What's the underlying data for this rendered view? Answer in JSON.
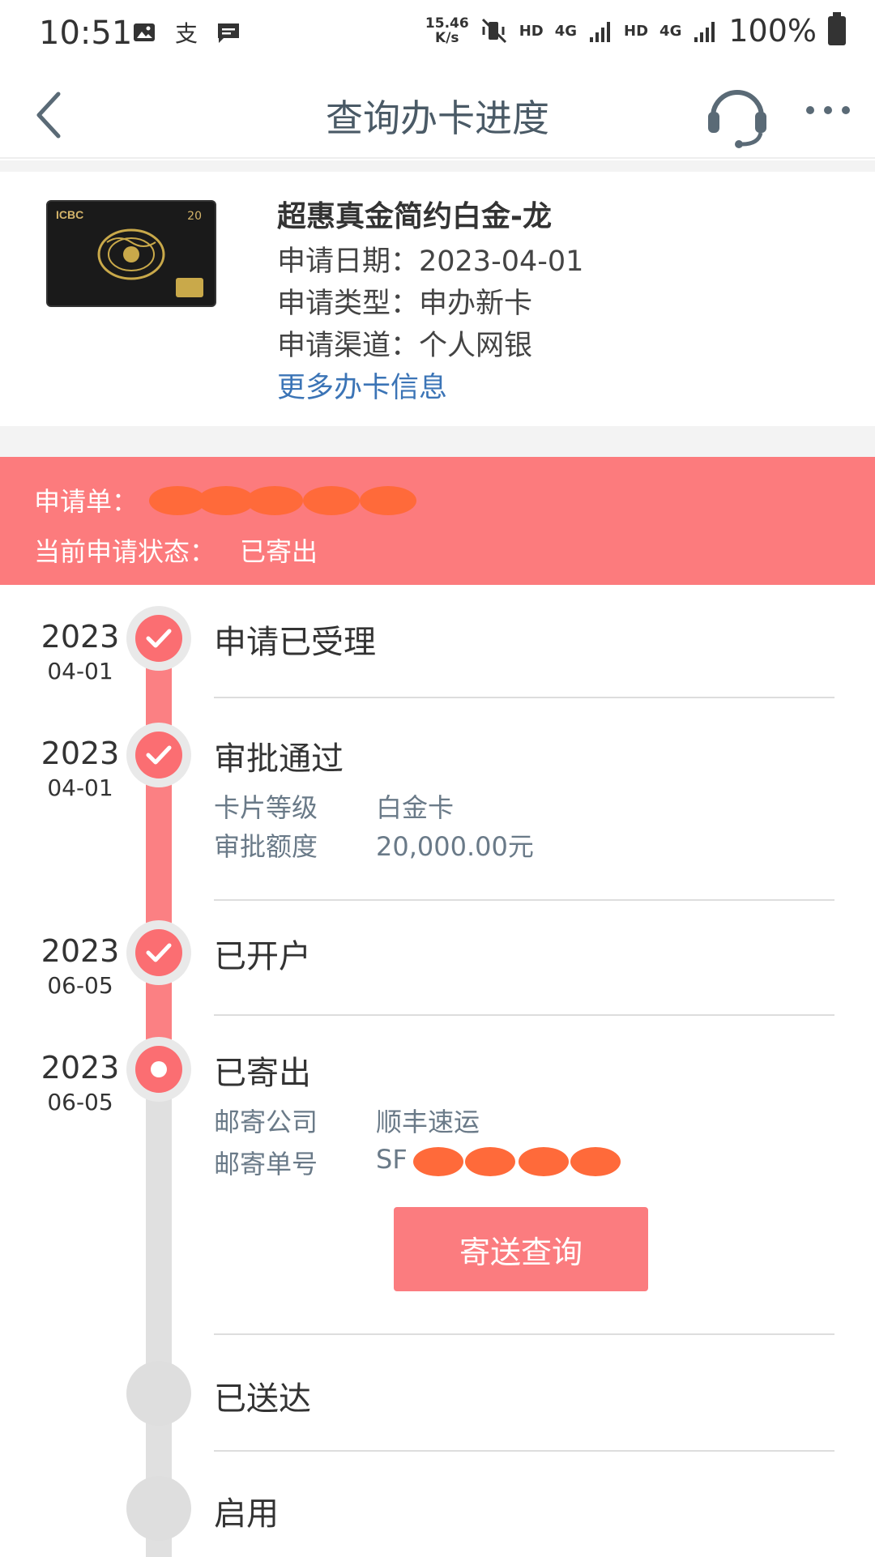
{
  "status_bar": {
    "time": "10:51",
    "speed_top": "15.46",
    "speed_bottom": "K/s",
    "net1": "HD",
    "net1_gen": "4G",
    "net2": "HD",
    "net2_gen": "4G",
    "battery": "100%"
  },
  "header": {
    "title": "查询办卡进度"
  },
  "card": {
    "brand": "ICBC",
    "emblem": "20",
    "name": "超惠真金简约白金-龙",
    "apply_date": "申请日期：2023-04-01",
    "apply_type": "申请类型：申办新卡",
    "apply_channel": "申请渠道：个人网银",
    "more_link": "更多办卡信息"
  },
  "banner": {
    "application_label": "申请单：",
    "status_label": "当前申请状态：",
    "status_value": "已寄出",
    "background_color": "#fc7b7d"
  },
  "timeline": {
    "steps": [
      {
        "year": "2023",
        "date": "04-01",
        "title": "申请已受理",
        "state": "done"
      },
      {
        "year": "2023",
        "date": "04-01",
        "title": "审批通过",
        "state": "done",
        "details": [
          {
            "label": "卡片等级",
            "value": "白金卡"
          },
          {
            "label": "审批额度",
            "value": "20,000.00元"
          }
        ]
      },
      {
        "year": "2023",
        "date": "06-05",
        "title": "已开户",
        "state": "done"
      },
      {
        "year": "2023",
        "date": "06-05",
        "title": "已寄出",
        "state": "current",
        "details": [
          {
            "label": "邮寄公司",
            "value": "顺丰速运"
          },
          {
            "label": "邮寄单号",
            "value": "SF"
          }
        ]
      },
      {
        "title": "已送达",
        "state": "todo"
      },
      {
        "title": "启用",
        "state": "todo"
      }
    ],
    "track_button": "寄送查询",
    "active_color": "#fb6e72",
    "inactive_color": "#e0e0e0"
  }
}
